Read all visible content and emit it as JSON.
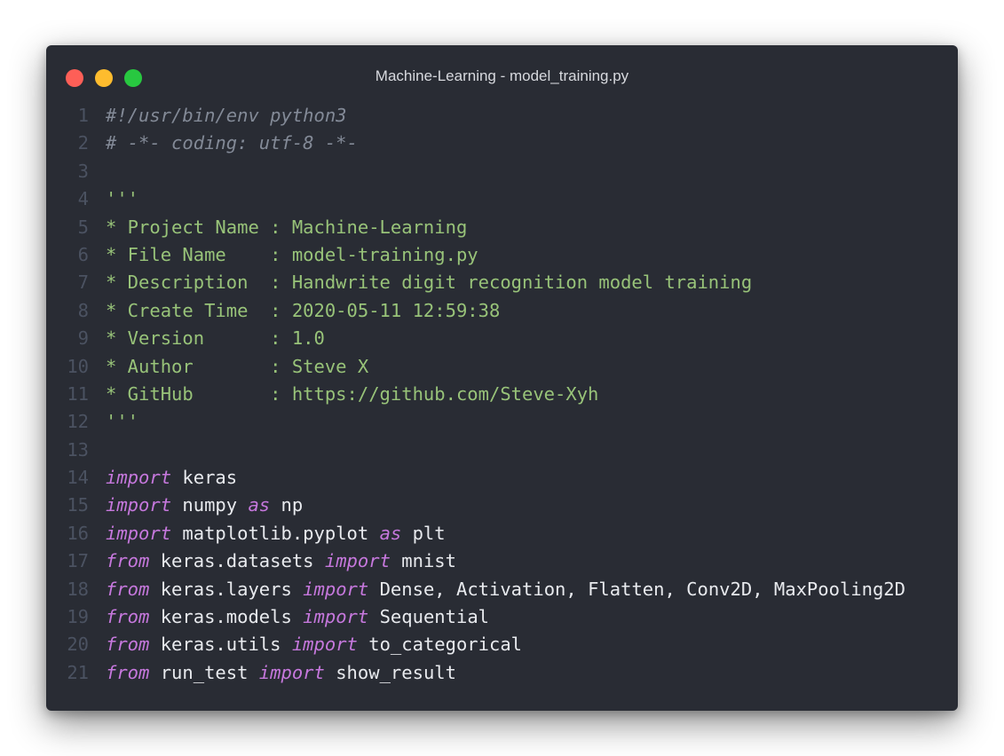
{
  "window": {
    "title": "Machine-Learning - model_training.py",
    "traffic_lights": [
      "close",
      "minimize",
      "zoom"
    ]
  },
  "colors": {
    "background": "#292c34",
    "line_number": "#4b5261",
    "comment": "#838a97",
    "string": "#98c379",
    "keyword": "#c678dd",
    "plain": "#e8eaee"
  },
  "code": {
    "lines": [
      {
        "n": "1",
        "tokens": [
          {
            "t": "#!/usr/bin/env python3",
            "k": "comment"
          }
        ]
      },
      {
        "n": "2",
        "tokens": [
          {
            "t": "# -*- coding: utf-8 -*-",
            "k": "comment"
          }
        ]
      },
      {
        "n": "3",
        "tokens": []
      },
      {
        "n": "4",
        "tokens": [
          {
            "t": "'''",
            "k": "string"
          }
        ]
      },
      {
        "n": "5",
        "tokens": [
          {
            "t": "* Project Name : Machine-Learning",
            "k": "string"
          }
        ]
      },
      {
        "n": "6",
        "tokens": [
          {
            "t": "* File Name    : model-training.py",
            "k": "string"
          }
        ]
      },
      {
        "n": "7",
        "tokens": [
          {
            "t": "* Description  : Handwrite digit recognition model training",
            "k": "string"
          }
        ]
      },
      {
        "n": "8",
        "tokens": [
          {
            "t": "* Create Time  : 2020-05-11 12:59:38",
            "k": "string"
          }
        ]
      },
      {
        "n": "9",
        "tokens": [
          {
            "t": "* Version      : 1.0",
            "k": "string"
          }
        ]
      },
      {
        "n": "10",
        "tokens": [
          {
            "t": "* Author       : Steve X",
            "k": "string"
          }
        ]
      },
      {
        "n": "11",
        "tokens": [
          {
            "t": "* GitHub       : https://github.com/Steve-Xyh",
            "k": "string"
          }
        ]
      },
      {
        "n": "12",
        "tokens": [
          {
            "t": "'''",
            "k": "string"
          }
        ]
      },
      {
        "n": "13",
        "tokens": []
      },
      {
        "n": "14",
        "tokens": [
          {
            "t": "import",
            "k": "keyword"
          },
          {
            "t": " keras",
            "k": "plain"
          }
        ]
      },
      {
        "n": "15",
        "tokens": [
          {
            "t": "import",
            "k": "keyword"
          },
          {
            "t": " numpy ",
            "k": "plain"
          },
          {
            "t": "as",
            "k": "keyword"
          },
          {
            "t": " np",
            "k": "plain"
          }
        ]
      },
      {
        "n": "16",
        "tokens": [
          {
            "t": "import",
            "k": "keyword"
          },
          {
            "t": " matplotlib.pyplot ",
            "k": "plain"
          },
          {
            "t": "as",
            "k": "keyword"
          },
          {
            "t": " plt",
            "k": "plain"
          }
        ]
      },
      {
        "n": "17",
        "tokens": [
          {
            "t": "from",
            "k": "keyword"
          },
          {
            "t": " keras.datasets ",
            "k": "plain"
          },
          {
            "t": "import",
            "k": "keyword"
          },
          {
            "t": " mnist",
            "k": "plain"
          }
        ]
      },
      {
        "n": "18",
        "tokens": [
          {
            "t": "from",
            "k": "keyword"
          },
          {
            "t": " keras.layers ",
            "k": "plain"
          },
          {
            "t": "import",
            "k": "keyword"
          },
          {
            "t": " Dense, Activation, Flatten, Conv2D, MaxPooling2D",
            "k": "plain"
          }
        ]
      },
      {
        "n": "19",
        "tokens": [
          {
            "t": "from",
            "k": "keyword"
          },
          {
            "t": " keras.models ",
            "k": "plain"
          },
          {
            "t": "import",
            "k": "keyword"
          },
          {
            "t": " Sequential",
            "k": "plain"
          }
        ]
      },
      {
        "n": "20",
        "tokens": [
          {
            "t": "from",
            "k": "keyword"
          },
          {
            "t": " keras.utils ",
            "k": "plain"
          },
          {
            "t": "import",
            "k": "keyword"
          },
          {
            "t": " to_categorical",
            "k": "plain"
          }
        ]
      },
      {
        "n": "21",
        "tokens": [
          {
            "t": "from",
            "k": "keyword"
          },
          {
            "t": " run_test ",
            "k": "plain"
          },
          {
            "t": "import",
            "k": "keyword"
          },
          {
            "t": " show_result",
            "k": "plain"
          }
        ]
      }
    ]
  }
}
